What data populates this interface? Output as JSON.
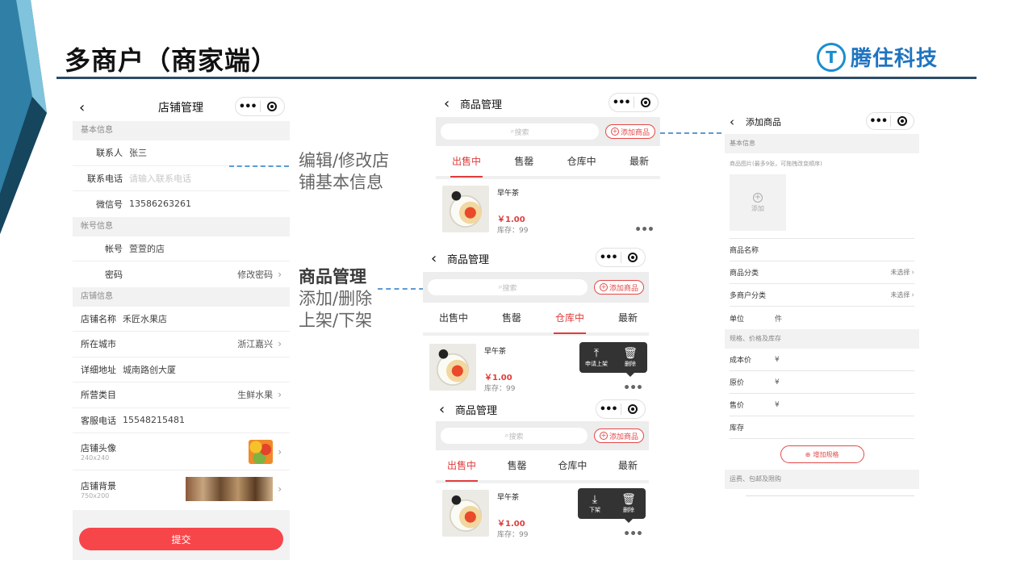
{
  "slide": {
    "title": "多商户（商家端）",
    "logo_text": "腾住科技",
    "logo_mark": "T"
  },
  "colors": {
    "accent_red": "#e54848",
    "submit_red": "#f7464a",
    "rule": "#2d4b66",
    "dash": "#5b9bd5"
  },
  "annotations": {
    "a1": [
      "编辑/修改店",
      "铺基本信息"
    ],
    "a2_title": "商品管理",
    "a2": [
      "添加/删除",
      "上架/下架"
    ]
  },
  "shop": {
    "title": "店铺管理",
    "sections": {
      "basic": "基本信息",
      "account": "帐号信息",
      "store": "店铺信息"
    },
    "contact_label": "联系人",
    "contact_value": "张三",
    "phone_label": "联系电话",
    "phone_placeholder": "请输入联系电话",
    "wechat_label": "微信号",
    "wechat_value": "13586263261",
    "account_label": "帐号",
    "account_value": "萱萱的店",
    "password_label": "密码",
    "password_action": "修改密码",
    "store_name_label": "店铺名称",
    "store_name_value": "禾匠水果店",
    "city_label": "所在城市",
    "city_value": "浙江嘉兴",
    "address_label": "详细地址",
    "address_value": "城南路创大厦",
    "category_label": "所营类目",
    "category_value": "生鲜水果",
    "service_label": "客服电话",
    "service_value": "15548215481",
    "avatar_label": "店铺头像",
    "avatar_size": "240x240",
    "bg_label": "店铺背景",
    "bg_size": "750x200",
    "submit": "提交"
  },
  "goods": {
    "title": "商品管理",
    "search": "搜索",
    "add": "添加商品",
    "tabs": [
      "出售中",
      "售罄",
      "仓库中",
      "最新"
    ],
    "product_name": "早午茶",
    "price": "￥1.00",
    "stock": "库存：99",
    "actions_warehouse": [
      "申请上架",
      "删除"
    ],
    "actions_selling": [
      "下架",
      "删除"
    ]
  },
  "add_product": {
    "title": "添加商品",
    "basic": "基本信息",
    "image_label": "商品图片",
    "image_hint": "(最多9张，可拖拽改变顺序)",
    "upload": "添加",
    "name_label": "商品名称",
    "cat_label": "商品分类",
    "cat_value": "未选择",
    "mcat_label": "多商户分类",
    "mcat_value": "未选择",
    "unit_label": "单位",
    "unit_value": "件",
    "spec_section": "规格、价格及库存",
    "cost_label": "成本价",
    "orig_label": "原价",
    "sale_label": "售价",
    "stock_label": "库存",
    "yen": "¥",
    "add_spec": "增加规格",
    "ship_section": "运费、包邮及限购"
  }
}
